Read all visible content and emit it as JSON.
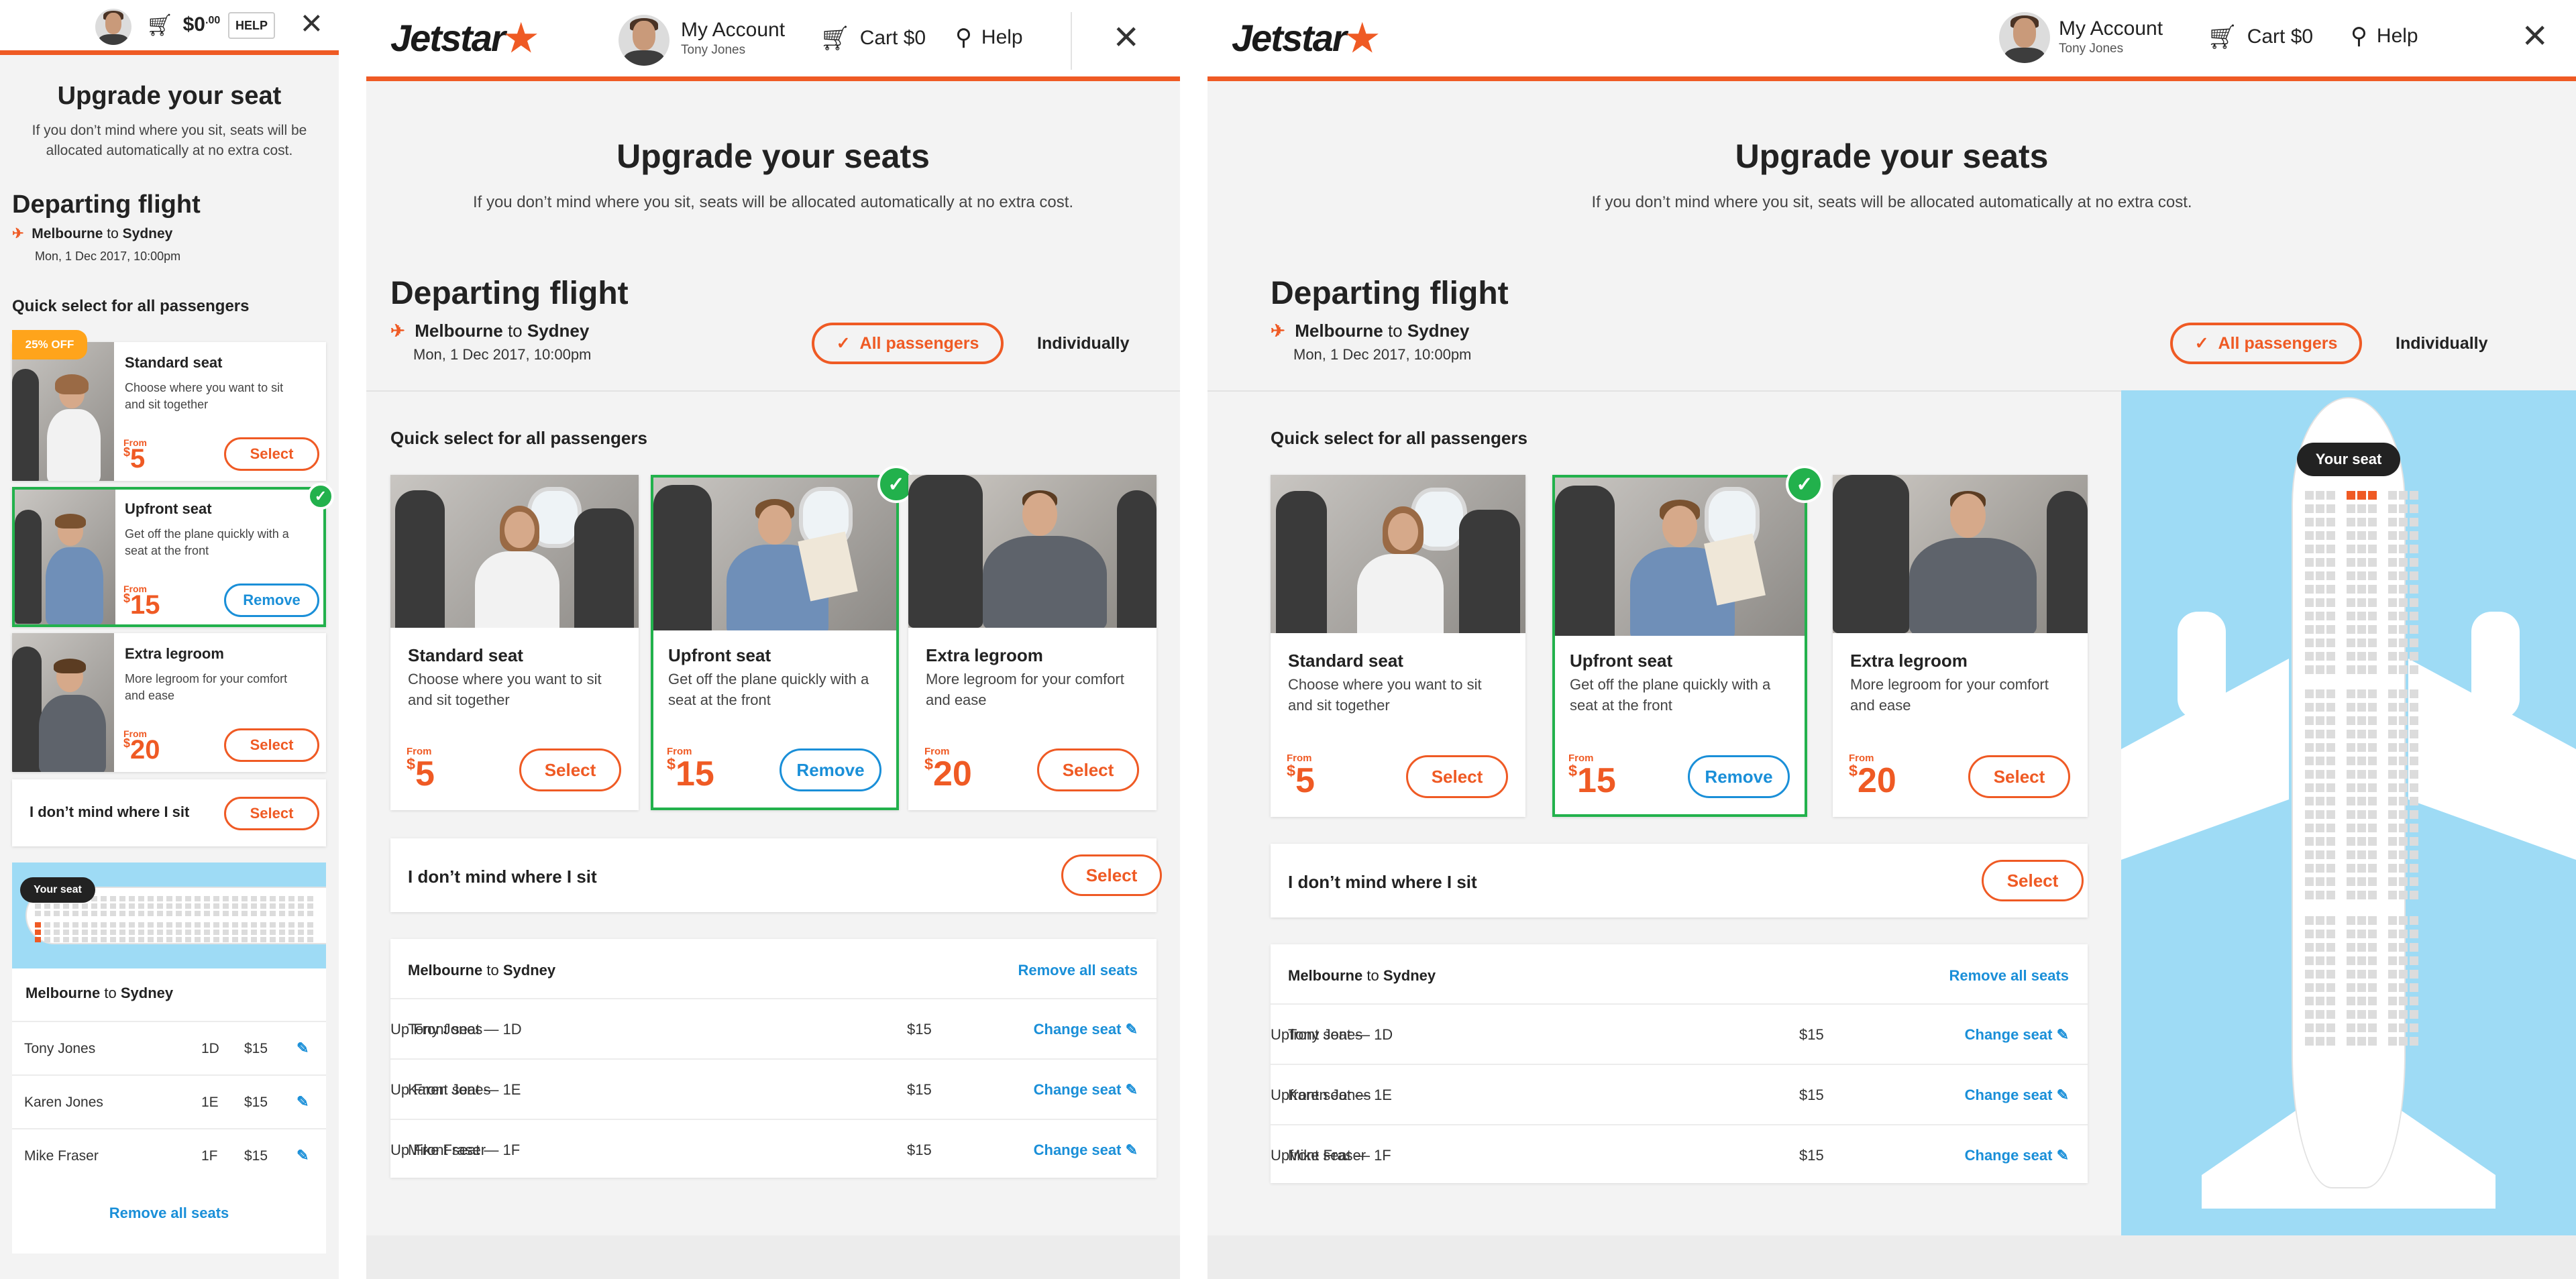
{
  "brand": {
    "logo": "Jetstar",
    "accent": "#ef5a24",
    "success": "#22b14c",
    "link": "#1a8fd8"
  },
  "header": {
    "account_label": "My Account",
    "account_name": "Tony Jones",
    "cart_label": "Cart",
    "cart_value": "$0",
    "help_label": "Help",
    "mobile_cart_dollars": "$0",
    "mobile_cart_cents": ".00",
    "mobile_help": "HELP"
  },
  "page": {
    "title_mobile": "Upgrade your seat",
    "title": "Upgrade your seats",
    "subtitle": "If you don’t mind where you sit, seats will be allocated automatically at no extra cost.",
    "mobile_subtitle_line1": "If you don’t mind where you sit, seats will be",
    "mobile_subtitle_line2": "allocated automatically at no extra cost."
  },
  "flight": {
    "heading": "Departing flight",
    "from": "Melbourne",
    "to_word": "to",
    "to": "Sydney",
    "date": "Mon, 1 Dec 2017, 10:00pm"
  },
  "toggle": {
    "all": "All passengers",
    "individually": "Individually"
  },
  "quick_select": "Quick select for all passengers",
  "badge": "25% OFF",
  "options": [
    {
      "title": "Standard seat",
      "desc": "Choose where you want to sit and sit together",
      "desc_l1": "Choose where you want to sit",
      "desc_l2": "and sit together",
      "from": "From",
      "currency": "$",
      "price": "5",
      "button": "Select"
    },
    {
      "title": "Upfront seat",
      "desc_l1": "Get off the plane quickly with a",
      "desc_l2": "seat at the front",
      "from": "From",
      "currency": "$",
      "price": "15",
      "button": "Remove"
    },
    {
      "title": "Extra legroom",
      "desc_l1": "More legroom for your comfort",
      "desc_l2": "and ease",
      "from": "From",
      "currency": "$",
      "price": "20",
      "button": "Select"
    }
  ],
  "dont_mind": {
    "label": "I don’t mind where I sit",
    "button": "Select"
  },
  "summary": {
    "route_from": "Melbourne",
    "route_to_word": "to",
    "route_to": "Sydney",
    "remove_all": "Remove all seats",
    "change": "Change seat",
    "rows_tablet": [
      {
        "name": "Tony Jones",
        "seat": "Up Front seat — 1D",
        "price": "$15"
      },
      {
        "name": "Karen Jones",
        "seat": "Up Front seat — 1E",
        "price": "$15"
      },
      {
        "name": "Mike Fraser",
        "seat": "Up Front seat — 1F",
        "price": "$15"
      }
    ],
    "rows_desktop": [
      {
        "name": "Tony Jones",
        "seat": "Upfront seat — 1D",
        "price": "$15"
      },
      {
        "name": "Karen Jones",
        "seat": "Upfront seat — 1E",
        "price": "$15"
      },
      {
        "name": "Mike Fraser",
        "seat": "Upfront seat — 1F",
        "price": "$15"
      }
    ],
    "rows_mobile": [
      {
        "name": "Tony Jones",
        "seat": "1D",
        "price": "$15"
      },
      {
        "name": "Karen Jones",
        "seat": "1E",
        "price": "$15"
      },
      {
        "name": "Mike Fraser",
        "seat": "1F",
        "price": "$15"
      }
    ]
  },
  "seatmap": {
    "tooltip": "Your seat",
    "sea_color": "#9edbf5",
    "selected_seats": [
      "1D",
      "1E",
      "1F"
    ]
  },
  "icons": {
    "close": "close-icon",
    "cart": "cart-icon",
    "search": "search-icon",
    "check": "check-icon",
    "plane": "plane-icon",
    "pencil": "pencil-icon",
    "logo_star": "star-icon"
  }
}
